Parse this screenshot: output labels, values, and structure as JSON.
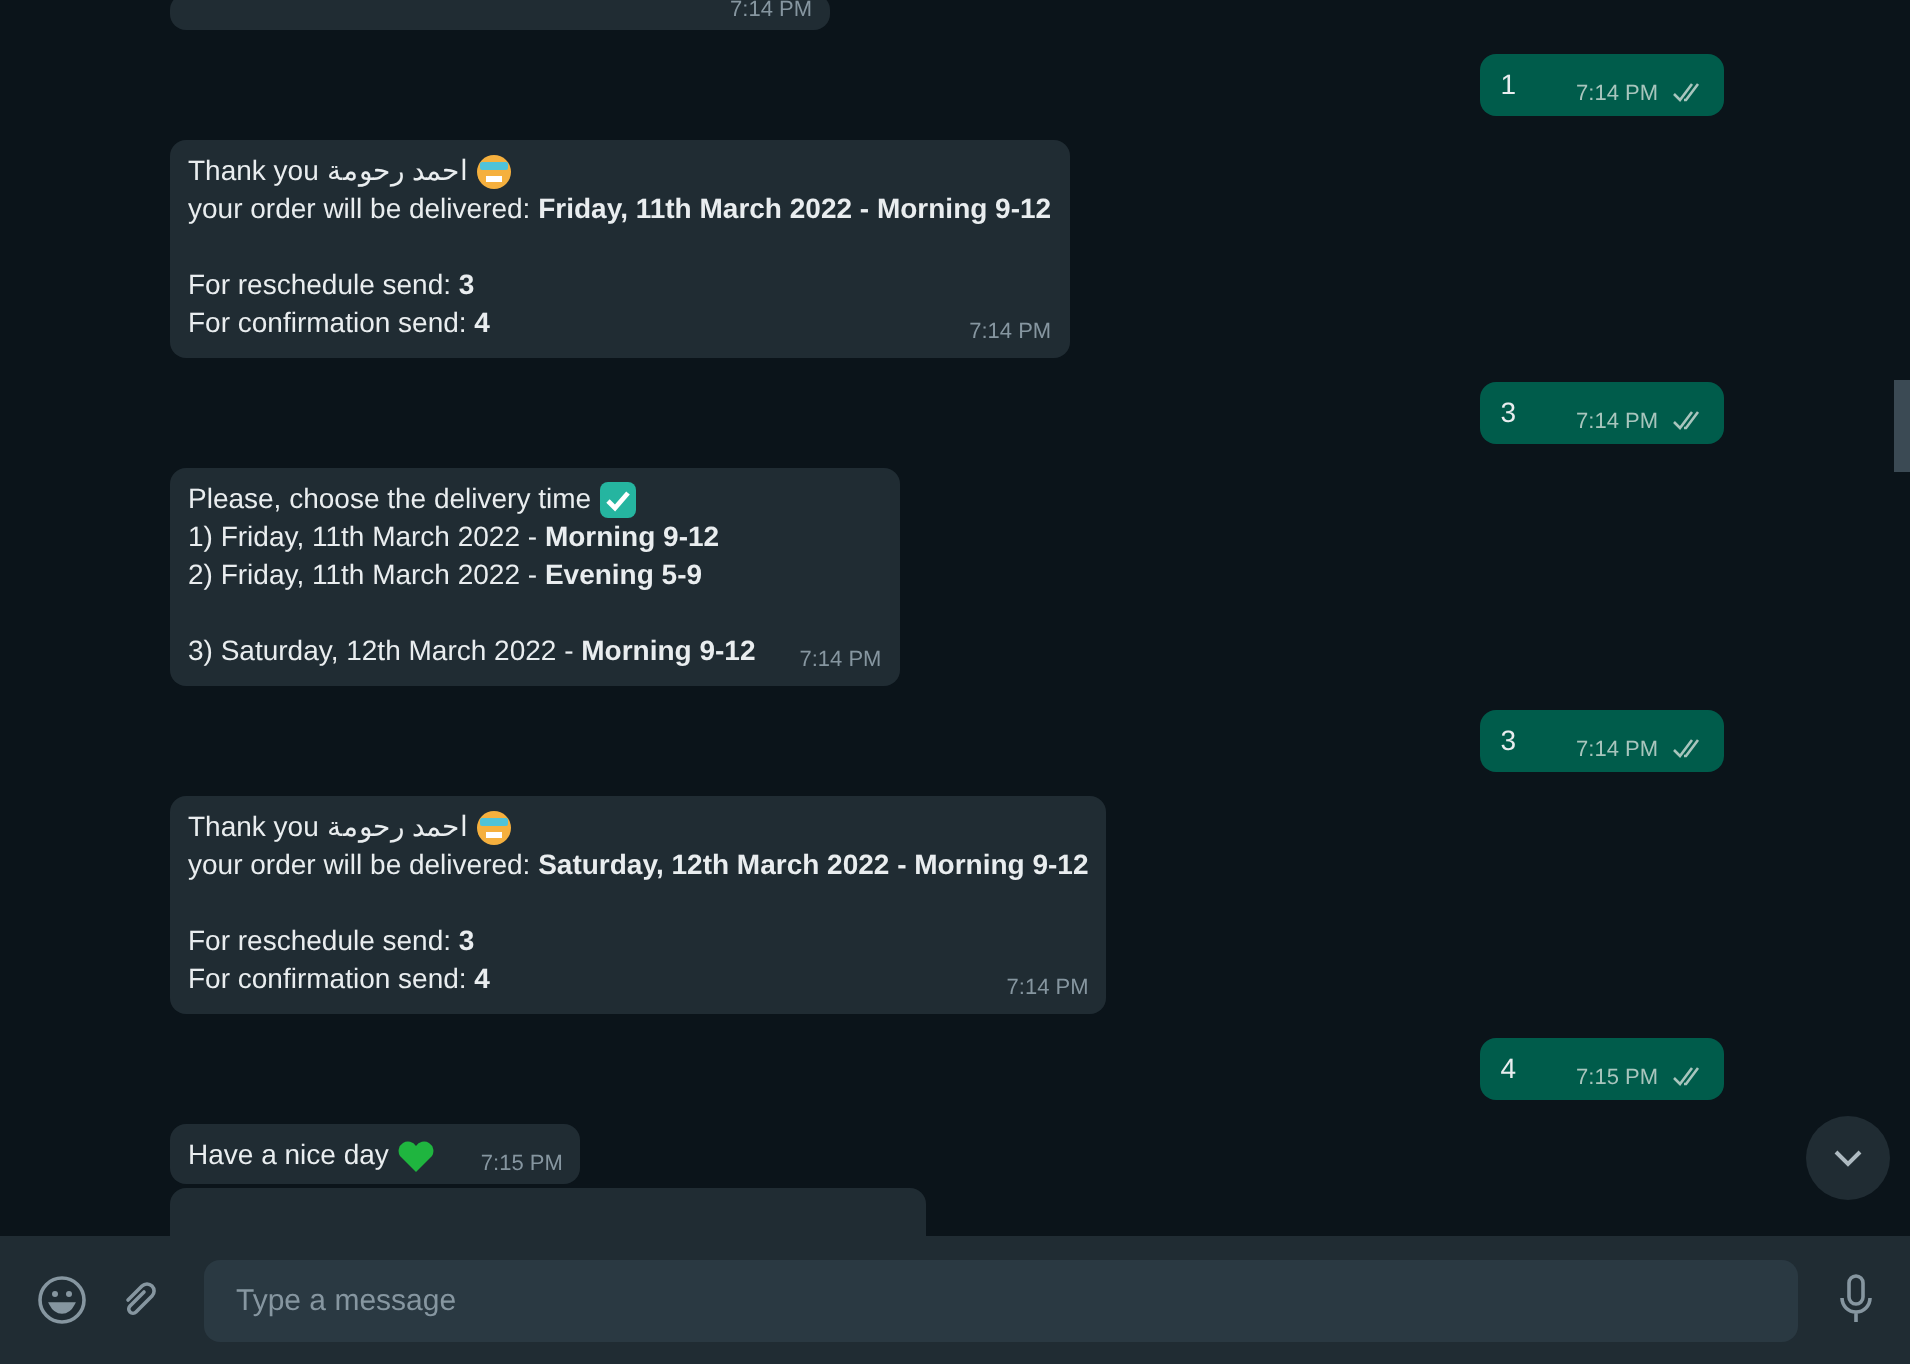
{
  "messages": [
    {
      "kind": "fragment",
      "time": "7:14 PM"
    },
    {
      "kind": "outgoing",
      "lines": [
        {
          "kind": "plain",
          "text": "1"
        }
      ],
      "time": "7:14 PM",
      "read": true
    },
    {
      "kind": "incoming",
      "lines": [
        {
          "kind": "face",
          "text": "Thank you احمد رحومة"
        },
        {
          "kind": "plain",
          "text": "your order will be delivered: **Friday, 11th March 2022 - Morning 9-12**"
        },
        {
          "kind": "plain",
          "text": "For reschedule send: **3**",
          "gap_before": true
        },
        {
          "kind": "plain",
          "text": "For confirmation send: **4**"
        }
      ],
      "time": "7:14 PM"
    },
    {
      "kind": "outgoing",
      "lines": [
        {
          "kind": "plain",
          "text": "3"
        }
      ],
      "time": "7:14 PM",
      "read": true
    },
    {
      "kind": "incoming",
      "lines": [
        {
          "kind": "check",
          "text": "Please, choose the delivery time"
        },
        {
          "kind": "plain",
          "text": "1) Friday, 11th March 2022 - **Morning 9-12**"
        },
        {
          "kind": "plain",
          "text": "2) Friday, 11th March 2022 - **Evening 5-9**"
        },
        {
          "kind": "plain",
          "text": "3) Saturday, 12th March 2022 - **Morning 9-12**",
          "gap_before": true
        }
      ],
      "time": "7:14 PM"
    },
    {
      "kind": "outgoing",
      "lines": [
        {
          "kind": "plain",
          "text": "3"
        }
      ],
      "time": "7:14 PM",
      "read": true
    },
    {
      "kind": "incoming",
      "lines": [
        {
          "kind": "face",
          "text": "Thank you احمد رحومة"
        },
        {
          "kind": "plain",
          "text": "your order will be delivered: **Saturday, 12th March 2022 - Morning 9-12**"
        },
        {
          "kind": "plain",
          "text": "For reschedule send: **3**",
          "gap_before": true
        },
        {
          "kind": "plain",
          "text": "For confirmation send: **4**"
        }
      ],
      "time": "7:14 PM"
    },
    {
      "kind": "outgoing",
      "lines": [
        {
          "kind": "plain",
          "text": "4"
        }
      ],
      "time": "7:15 PM",
      "read": true
    },
    {
      "kind": "incoming",
      "lines": [
        {
          "kind": "heart",
          "text": "Have a nice day"
        }
      ],
      "time": "7:15 PM"
    },
    {
      "kind": "fragment"
    }
  ],
  "composer": {
    "placeholder": "Type a message"
  }
}
